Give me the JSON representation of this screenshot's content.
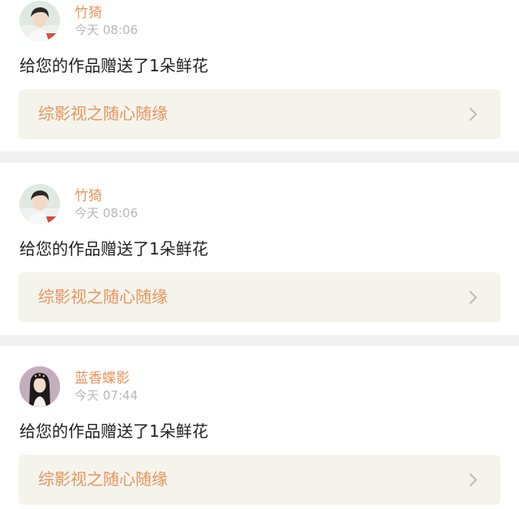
{
  "colors": {
    "accent": "#e8955c",
    "timestamp": "#b8b8b8",
    "text": "#222222",
    "link_bg": "#f4f4ed",
    "divider": "#f1f1f1",
    "chevron": "#bbbbbb"
  },
  "notifications": [
    {
      "user": "竹猗",
      "time": "今天 08:06",
      "message": "给您的作品赠送了1朵鲜花",
      "work_title": "综影视之随心随缘",
      "avatar_icon": "male-avatar-icon",
      "arrow_icon": "chevron-right-icon"
    },
    {
      "user": "竹猗",
      "time": "今天 08:06",
      "message": "给您的作品赠送了1朵鲜花",
      "work_title": "综影视之随心随缘",
      "avatar_icon": "male-avatar-icon",
      "arrow_icon": "chevron-right-icon"
    },
    {
      "user": "蓝香蝶影",
      "time": "今天 07:44",
      "message": "给您的作品赠送了1朵鲜花",
      "work_title": "综影视之随心随缘",
      "avatar_icon": "female-avatar-icon",
      "arrow_icon": "chevron-right-icon"
    }
  ]
}
